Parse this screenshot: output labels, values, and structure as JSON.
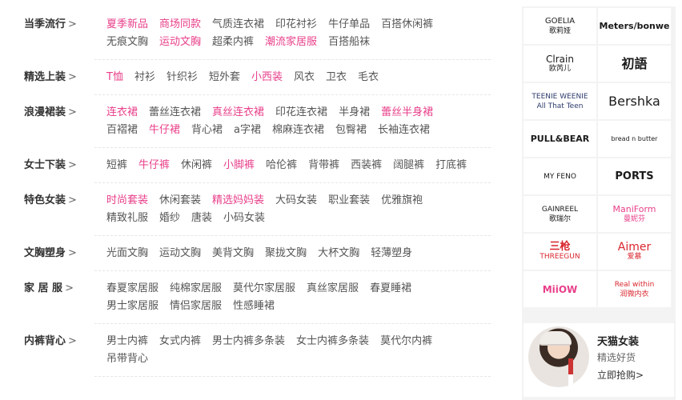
{
  "categories": [
    {
      "title": "当季流行",
      "chevron": ">",
      "lines": [
        [
          {
            "label": "夏季新品",
            "hot": true
          },
          {
            "label": "商场同款",
            "hot": true
          },
          {
            "label": "气质连衣裙",
            "hot": false
          },
          {
            "label": "印花衬衫",
            "hot": false
          },
          {
            "label": "牛仔单品",
            "hot": false
          },
          {
            "label": "百搭休闲裤",
            "hot": false
          }
        ],
        [
          {
            "label": "无痕文胸",
            "hot": false
          },
          {
            "label": "运动文胸",
            "hot": true
          },
          {
            "label": "超柔内裤",
            "hot": false
          },
          {
            "label": "潮流家居服",
            "hot": true
          },
          {
            "label": "百搭船袜",
            "hot": false
          }
        ]
      ]
    },
    {
      "title": "精选上装",
      "chevron": ">",
      "lines": [
        [
          {
            "label": "T恤",
            "hot": true
          },
          {
            "label": "衬衫",
            "hot": false
          },
          {
            "label": "针织衫",
            "hot": false
          },
          {
            "label": "短外套",
            "hot": false
          },
          {
            "label": "小西装",
            "hot": true
          },
          {
            "label": "风衣",
            "hot": false
          },
          {
            "label": "卫衣",
            "hot": false
          },
          {
            "label": "毛衣",
            "hot": false
          }
        ]
      ]
    },
    {
      "title": "浪漫裙装",
      "chevron": ">",
      "lines": [
        [
          {
            "label": "连衣裙",
            "hot": true
          },
          {
            "label": "蕾丝连衣裙",
            "hot": false
          },
          {
            "label": "真丝连衣裙",
            "hot": true
          },
          {
            "label": "印花连衣裙",
            "hot": false
          },
          {
            "label": "半身裙",
            "hot": false
          },
          {
            "label": "蕾丝半身裙",
            "hot": true
          }
        ],
        [
          {
            "label": "百褶裙",
            "hot": false
          },
          {
            "label": "牛仔裙",
            "hot": true
          },
          {
            "label": "背心裙",
            "hot": false
          },
          {
            "label": "a字裙",
            "hot": false
          },
          {
            "label": "棉麻连衣裙",
            "hot": false
          },
          {
            "label": "包臀裙",
            "hot": false
          },
          {
            "label": "长袖连衣裙",
            "hot": false
          }
        ]
      ]
    },
    {
      "title": "女士下装",
      "chevron": ">",
      "lines": [
        [
          {
            "label": "短裤",
            "hot": false
          },
          {
            "label": "牛仔裤",
            "hot": true
          },
          {
            "label": "休闲裤",
            "hot": false
          },
          {
            "label": "小脚裤",
            "hot": true
          },
          {
            "label": "哈伦裤",
            "hot": false
          },
          {
            "label": "背带裤",
            "hot": false
          },
          {
            "label": "西装裤",
            "hot": false
          },
          {
            "label": "阔腿裤",
            "hot": false
          },
          {
            "label": "打底裤",
            "hot": false
          }
        ]
      ]
    },
    {
      "title": "特色女装",
      "chevron": ">",
      "lines": [
        [
          {
            "label": "时尚套装",
            "hot": true
          },
          {
            "label": "休闲套装",
            "hot": false
          },
          {
            "label": "精选妈妈装",
            "hot": true
          },
          {
            "label": "大码女装",
            "hot": false
          },
          {
            "label": "职业套装",
            "hot": false
          },
          {
            "label": "优雅旗袍",
            "hot": false
          }
        ],
        [
          {
            "label": "精致礼服",
            "hot": false
          },
          {
            "label": "婚纱",
            "hot": false
          },
          {
            "label": "唐装",
            "hot": false
          },
          {
            "label": "小码女装",
            "hot": false
          }
        ]
      ]
    },
    {
      "title": "文胸塑身",
      "chevron": ">",
      "lines": [
        [
          {
            "label": "光面文胸",
            "hot": false
          },
          {
            "label": "运动文胸",
            "hot": false
          },
          {
            "label": "美背文胸",
            "hot": false
          },
          {
            "label": "聚拢文胸",
            "hot": false
          },
          {
            "label": "大杯文胸",
            "hot": false
          },
          {
            "label": "轻薄塑身",
            "hot": false
          }
        ]
      ]
    },
    {
      "title": "家 居 服",
      "chevron": ">",
      "lines": [
        [
          {
            "label": "春夏家居服",
            "hot": false
          },
          {
            "label": "纯棉家居服",
            "hot": false
          },
          {
            "label": "莫代尔家居服",
            "hot": false
          },
          {
            "label": "真丝家居服",
            "hot": false
          },
          {
            "label": "春夏睡裙",
            "hot": false
          }
        ],
        [
          {
            "label": "男士家居服",
            "hot": false
          },
          {
            "label": "情侣家居服",
            "hot": false
          },
          {
            "label": "性感睡裙",
            "hot": false
          }
        ]
      ]
    },
    {
      "title": "内裤背心",
      "chevron": ">",
      "lines": [
        [
          {
            "label": "男士内裤",
            "hot": false
          },
          {
            "label": "女式内裤",
            "hot": false
          },
          {
            "label": "男士内裤多条装",
            "hot": false
          },
          {
            "label": "女士内裤多条装",
            "hot": false
          },
          {
            "label": "莫代尔内裤",
            "hot": false
          }
        ],
        [
          {
            "label": "吊带背心",
            "hot": false
          }
        ]
      ]
    }
  ],
  "brands": [
    {
      "name": "GOELIA",
      "sub": "歌莉娅"
    },
    {
      "name": "Meters/bonwe",
      "sub": ""
    },
    {
      "name": "Clrain",
      "sub": "欧芮儿"
    },
    {
      "name": "初語",
      "sub": ""
    },
    {
      "name": "TEENIE WEENIE",
      "sub": "All That Teen"
    },
    {
      "name": "Bershka",
      "sub": ""
    },
    {
      "name": "PULL&BEAR",
      "sub": ""
    },
    {
      "name": "bread n butter",
      "sub": ""
    },
    {
      "name": "MY FENO",
      "sub": ""
    },
    {
      "name": "PORTS",
      "sub": ""
    },
    {
      "name": "GAINREEL",
      "sub": "歌瑞尔"
    },
    {
      "name": "ManiForm",
      "sub": "曼妮芬"
    },
    {
      "name": "三枪",
      "sub": "THREEGUN"
    },
    {
      "name": "Aimer",
      "sub": "爱慕"
    },
    {
      "name": "MiiOW",
      "sub": ""
    },
    {
      "name": "Real within",
      "sub": "润微内衣"
    }
  ],
  "brand_colors": {
    "pink": "#e83f8a",
    "red": "#d9262e",
    "dark": "#1a1a1a",
    "navy": "#2c3a6b"
  },
  "promo": {
    "title": "天猫女装",
    "subtitle": "精选好货",
    "cta": "立即抢购>"
  },
  "colors": {
    "hot_link": "#e83f8a",
    "normal_link": "#555555",
    "title": "#333333",
    "sidebar_bg": "#f3f3f3"
  }
}
